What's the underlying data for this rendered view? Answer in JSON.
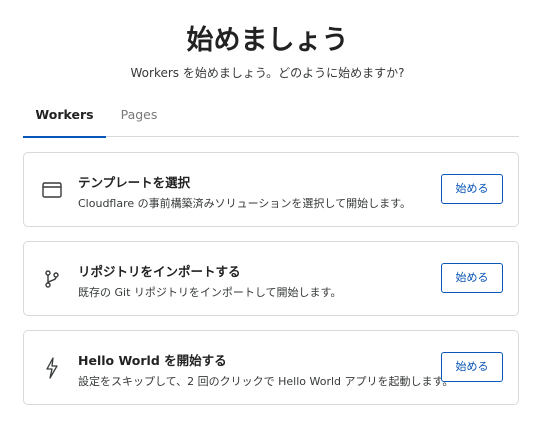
{
  "header": {
    "title": "始めましょう",
    "subtitle": "Workers を始めましょう。どのように始めますか?"
  },
  "tabs": [
    {
      "label": "Workers",
      "active": true
    },
    {
      "label": "Pages",
      "active": false
    }
  ],
  "cards": [
    {
      "icon": "browser-window-icon",
      "title": "テンプレートを選択",
      "description": "Cloudflare の事前構築済みソリューションを選択して開始します。",
      "button": "始める"
    },
    {
      "icon": "git-branch-icon",
      "title": "リポジトリをインポートする",
      "description": "既存の Git リポジトリをインポートして開始します。",
      "button": "始める"
    },
    {
      "icon": "lightning-bolt-icon",
      "title": "Hello World を開始する",
      "description": "設定をスキップして、2 回のクリックで Hello World アプリを起動します。",
      "button": "始める"
    }
  ],
  "colors": {
    "accent": "#0a55b8",
    "border": "#d9d9d9",
    "text": "#36393a"
  }
}
